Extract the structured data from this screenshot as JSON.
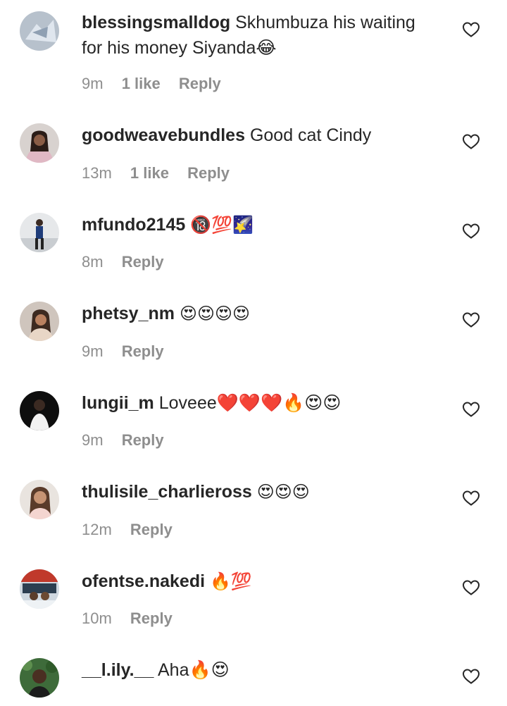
{
  "comments": [
    {
      "username": "blessingsmalldog",
      "text": "Skhumbuza his waiting for his money Siyanda😂",
      "time": "9m",
      "likes": "1 like",
      "reply": "Reply"
    },
    {
      "username": "goodweavebundles",
      "text": "Good cat Cindy",
      "time": "13m",
      "likes": "1 like",
      "reply": "Reply"
    },
    {
      "username": "mfundo2145",
      "text": "🔞💯🌠",
      "time": "8m",
      "likes": "",
      "reply": "Reply"
    },
    {
      "username": "phetsy_nm",
      "text": "😍😍😍😍",
      "time": "9m",
      "likes": "",
      "reply": "Reply"
    },
    {
      "username": "lungii_m",
      "text": "Loveee❤️❤️❤️🔥😍😍",
      "time": "9m",
      "likes": "",
      "reply": "Reply"
    },
    {
      "username": "thulisile_charlieross",
      "text": "😍😍😍",
      "time": "12m",
      "likes": "",
      "reply": "Reply"
    },
    {
      "username": "ofentse.nakedi",
      "text": "🔥💯",
      "time": "10m",
      "likes": "",
      "reply": "Reply"
    },
    {
      "username": "__l.ily.__",
      "text": "Aha🔥😍",
      "time": "",
      "likes": "",
      "reply": ""
    }
  ],
  "colors": {
    "text": "#262626",
    "meta": "#8e8e8e",
    "heart_stroke": "#262626"
  },
  "icons": {
    "like": "heart-outline-icon"
  }
}
